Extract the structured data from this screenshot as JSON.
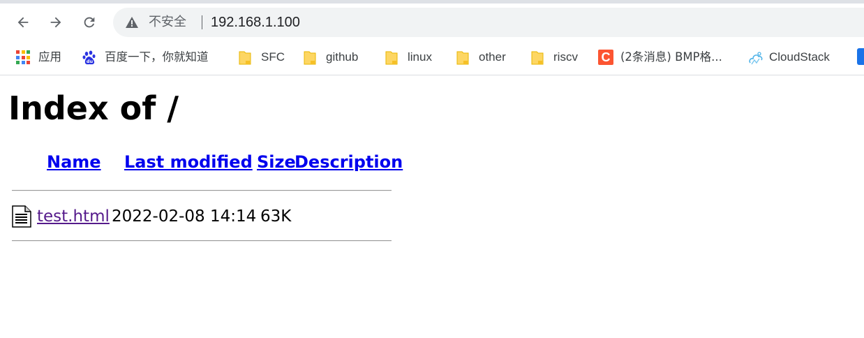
{
  "browser": {
    "nav": {
      "back_icon": "arrow-left-icon",
      "forward_icon": "arrow-right-icon",
      "reload_icon": "reload-icon"
    },
    "omnibox": {
      "security_label": "不安全",
      "url": "192.168.1.100",
      "warning_icon": "warning-triangle-icon"
    },
    "bookmarks": [
      {
        "label": "应用",
        "icon": "apps-grid-icon"
      },
      {
        "label": "百度一下，你就知道",
        "icon": "baidu-paw-icon"
      },
      {
        "label": "SFC",
        "icon": "folder-icon"
      },
      {
        "label": "github",
        "icon": "folder-icon"
      },
      {
        "label": "linux",
        "icon": "folder-icon"
      },
      {
        "label": "other",
        "icon": "folder-icon"
      },
      {
        "label": "riscv",
        "icon": "folder-icon"
      },
      {
        "label": "(2条消息) BMP格...",
        "icon": "csdn-c-icon"
      },
      {
        "label": "CloudStack",
        "icon": "cloudstack-icon"
      }
    ],
    "colors": {
      "folder": "#fdd663",
      "csdn": "#fc5531",
      "link": "#0000ee",
      "visited_link": "#551a8b"
    }
  },
  "page": {
    "heading": "Index of /",
    "columns": [
      "Name",
      "Last modified",
      "Size",
      "Description"
    ],
    "rows": [
      {
        "name": "test.html",
        "last_modified": "2022-02-08 14:14",
        "size": "63K",
        "description": "",
        "icon": "text-file-icon"
      }
    ]
  }
}
